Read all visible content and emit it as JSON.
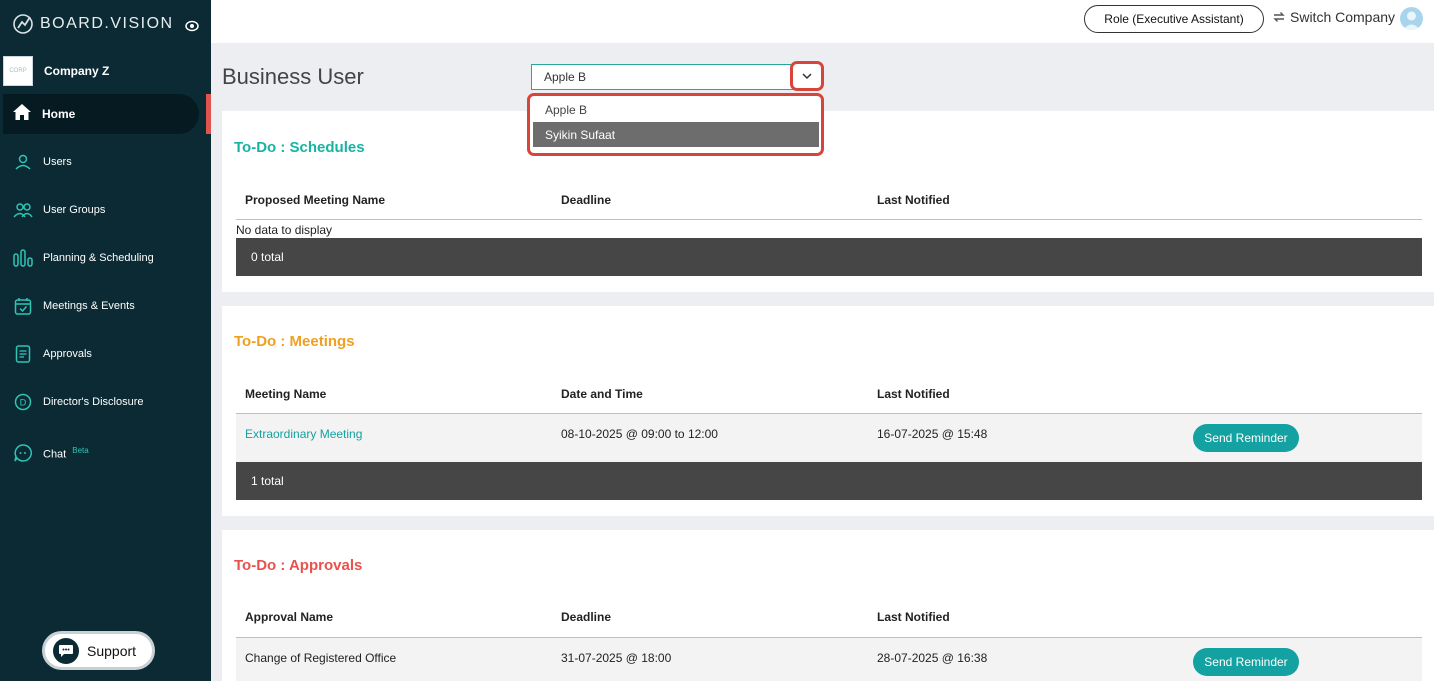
{
  "brand": {
    "name": "BOARD.VISION"
  },
  "sidebar": {
    "company": {
      "name": "Company Z"
    },
    "items": [
      {
        "label": "Home"
      },
      {
        "label": "Users"
      },
      {
        "label": "User Groups"
      },
      {
        "label": "Planning & Scheduling"
      },
      {
        "label": "Meetings & Events"
      },
      {
        "label": "Approvals"
      },
      {
        "label": "Director's Disclosure"
      },
      {
        "label": "Chat",
        "badge": "Beta"
      }
    ],
    "support_label": "Support"
  },
  "topbar": {
    "role_label": "Role (Executive Assistant)",
    "switch_label": "Switch Company"
  },
  "header": {
    "title": "Business User",
    "select": {
      "value": "Apple B",
      "options": [
        "Apple B",
        "Syikin Sufaat"
      ],
      "highlighted": "Syikin Sufaat"
    }
  },
  "schedules": {
    "title": "To-Do : Schedules",
    "columns": [
      "Proposed Meeting Name",
      "Deadline",
      "Last Notified"
    ],
    "empty_text": "No data to display",
    "total": "0 total"
  },
  "meetings": {
    "title": "To-Do : Meetings",
    "columns": [
      "Meeting Name",
      "Date and Time",
      "Last Notified"
    ],
    "rows": [
      {
        "name": "Extraordinary Meeting",
        "datetime": "08-10-2025 @ 09:00 to 12:00",
        "last_notified": "16-07-2025 @ 15:48",
        "action": "Send Reminder"
      }
    ],
    "total": "1 total"
  },
  "approvals": {
    "title": "To-Do : Approvals",
    "columns": [
      "Approval Name",
      "Deadline",
      "Last Notified"
    ],
    "rows": [
      {
        "name": "Change of Registered Office",
        "deadline": "31-07-2025 @ 18:00",
        "last_notified": "28-07-2025 @ 16:38",
        "action": "Send Reminder"
      }
    ]
  },
  "colors": {
    "sidebar_bg": "#0b2a33",
    "accent_teal": "#13a1a1",
    "schedules_title": "#17b3a3",
    "meetings_title": "#f0a020",
    "approvals_title": "#e8524e",
    "highlight_red": "#d9443a"
  }
}
